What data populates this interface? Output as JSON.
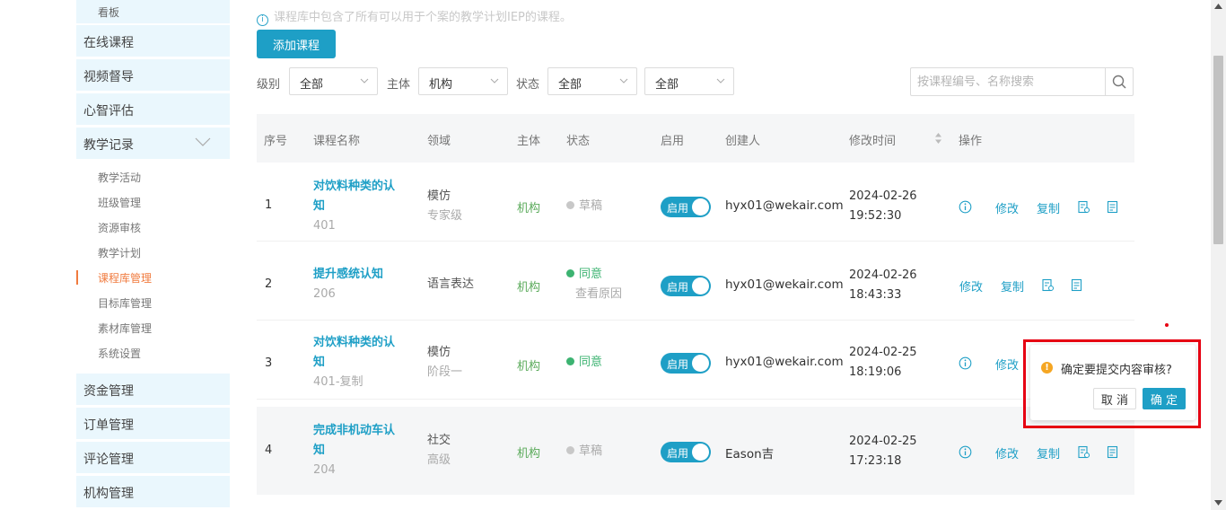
{
  "sidebar": {
    "top_sub": "看板",
    "items_top": [
      "在线课程",
      "视频督导",
      "心智评估",
      "教学记录"
    ],
    "sub_items": [
      "教学活动",
      "班级管理",
      "资源审核",
      "教学计划",
      "课程库管理",
      "目标库管理",
      "素材库管理",
      "系统设置"
    ],
    "active_sub": "课程库管理",
    "items_bottom": [
      "资金管理",
      "订单管理",
      "评论管理",
      "机构管理"
    ]
  },
  "notice": "课程库中包含了所有可以用于个案的教学计划IEP的课程。",
  "add_button": "添加课程",
  "filters": {
    "level_label": "级别",
    "level_value": "全部",
    "subject_label": "主体",
    "subject_value": "机构",
    "status_label": "状态",
    "status_value": "全部",
    "extra_value": "全部"
  },
  "search": {
    "placeholder": "按课程编号、名称搜索"
  },
  "table": {
    "headers": {
      "index": "序号",
      "name": "课程名称",
      "domain": "领域",
      "subject": "主体",
      "status": "状态",
      "enable": "启用",
      "creator": "创建人",
      "modified": "修改时间",
      "actions": "操作"
    },
    "rows": [
      {
        "index": "1",
        "name_l1": "对饮料种类的认",
        "name_l2": "知",
        "code": "401",
        "domain": "模仿",
        "domain_sub": "专家级",
        "subject": "机构",
        "status": "草稿",
        "status_reason": "",
        "enable": "启用",
        "creator": "hyx01@wekair.com",
        "date": "2024-02-26",
        "time": "19:52:30",
        "edit": "修改",
        "copy": "复制"
      },
      {
        "index": "2",
        "name_l1": "提升感统认知",
        "name_l2": "",
        "code": "206",
        "domain": "语言表达",
        "domain_sub": "",
        "subject": "机构",
        "status": "同意",
        "status_reason": "查看原因",
        "enable": "启用",
        "creator": "hyx01@wekair.com",
        "date": "2024-02-26",
        "time": "18:43:33",
        "edit": "修改",
        "copy": "复制"
      },
      {
        "index": "3",
        "name_l1": "对饮料种类的认",
        "name_l2": "知",
        "code": "401-复制",
        "domain": "模仿",
        "domain_sub": "阶段一",
        "subject": "机构",
        "status": "同意",
        "status_reason": "",
        "enable": "启用",
        "creator": "hyx01@wekair.com",
        "date": "2024-02-25",
        "time": "18:19:06",
        "edit": "修改",
        "copy": ""
      },
      {
        "index": "4",
        "name_l1": "完成非机动车认",
        "name_l2": "知",
        "code": "204",
        "domain": "社交",
        "domain_sub": "高级",
        "subject": "机构",
        "status": "草稿",
        "status_reason": "",
        "enable": "启用",
        "creator": "Eason吉",
        "date": "2024-02-25",
        "time": "17:23:18",
        "edit": "修改",
        "copy": "复制"
      }
    ]
  },
  "popconfirm": {
    "message": "确定要提交内容审核?",
    "cancel": "取 消",
    "confirm": "确 定"
  },
  "colors": {
    "accent": "#1e9fc6",
    "active": "#f07b3f",
    "highlight": "#e60012",
    "warning": "#f5a623",
    "success": "#3cb371"
  }
}
